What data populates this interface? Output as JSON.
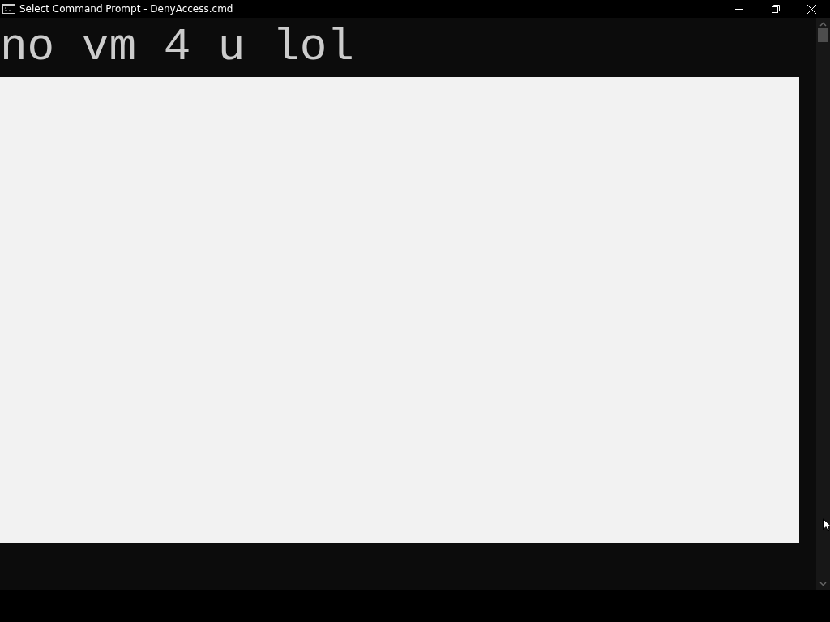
{
  "window": {
    "title": "Select Command Prompt - DenyAccess.cmd"
  },
  "console": {
    "lines": [
      "no vm 4 u lol"
    ]
  }
}
